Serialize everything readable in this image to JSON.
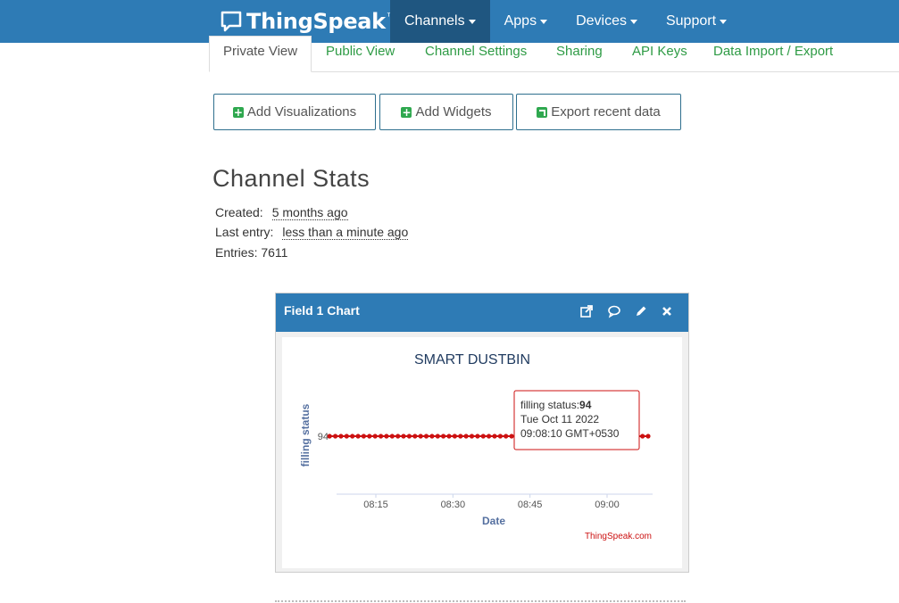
{
  "brand": {
    "name": "ThingSpeak",
    "tm": "™"
  },
  "nav": [
    {
      "label": "Channels",
      "active": true
    },
    {
      "label": "Apps"
    },
    {
      "label": "Devices"
    },
    {
      "label": "Support"
    }
  ],
  "tabs": [
    "Private View",
    "Public View",
    "Channel Settings",
    "Sharing",
    "API Keys",
    "Data Import / Export"
  ],
  "buttons": {
    "add_visualizations": "Add Visualizations",
    "add_widgets": "Add Widgets",
    "export_recent": "Export recent data"
  },
  "stats": {
    "title": "Channel Stats",
    "created_label": "Created:",
    "created_value": "5 months ago",
    "last_entry_label": "Last entry:",
    "last_entry_value": "less than a minute ago",
    "entries_label": "Entries:",
    "entries_value": "7611"
  },
  "panel": {
    "title": "Field 1 Chart",
    "icons": [
      "external-link-icon",
      "comment-icon",
      "pencil-icon",
      "close-icon"
    ]
  },
  "chart_data": {
    "type": "line",
    "title": "SMART DUSTBIN",
    "xlabel": "Date",
    "ylabel": "filling status",
    "x_ticks": [
      "08:15",
      "08:30",
      "08:45",
      "09:00"
    ],
    "y_ticks": [
      "94"
    ],
    "series": [
      {
        "color": "#cc1111",
        "x_start": "08:06",
        "x_end": "09:08",
        "value": 94,
        "point_count": 57
      }
    ],
    "tooltip": {
      "label": "filling status:",
      "value": "94",
      "date": "Tue Oct 11 2022",
      "time": "09:08:10 GMT+0530"
    },
    "credit": "ThingSpeak.com",
    "grid": false
  }
}
